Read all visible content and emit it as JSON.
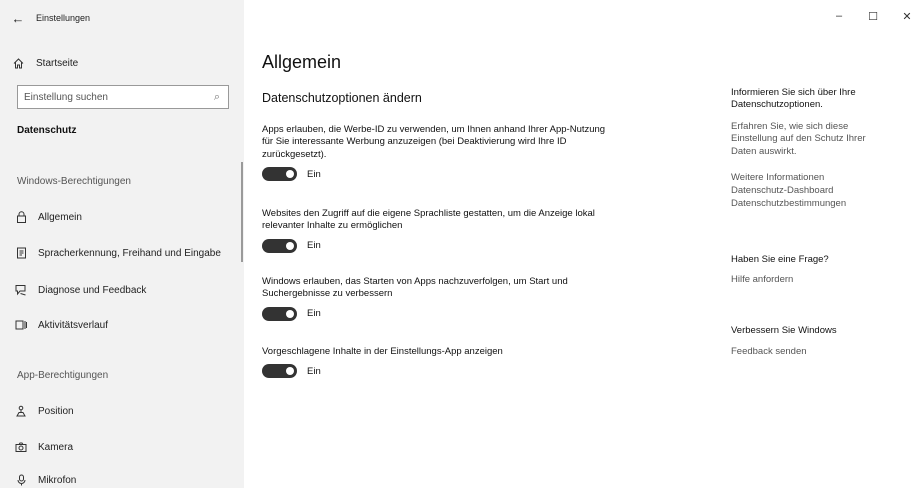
{
  "window": {
    "title": "Einstellungen",
    "controls": {
      "minimize": "–",
      "maximize": "☐",
      "close": "✕"
    }
  },
  "sidebar": {
    "home": {
      "label": "Startseite",
      "icon": "home-icon"
    },
    "search": {
      "placeholder": "Einstellung suchen",
      "value": ""
    },
    "section_title": "Datenschutz",
    "windows_permissions_heading": "Windows-Berechtigungen",
    "windows_items": [
      {
        "label": "Allgemein",
        "icon": "lock-icon",
        "selected": true
      },
      {
        "label": "Spracherkennung, Freihand und Eingabe",
        "icon": "speech-icon"
      },
      {
        "label": "Diagnose und Feedback",
        "icon": "feedback-icon"
      },
      {
        "label": "Aktivitätsverlauf",
        "icon": "activity-icon"
      }
    ],
    "app_permissions_heading": "App-Berechtigungen",
    "app_items": [
      {
        "label": "Position",
        "icon": "location-icon"
      },
      {
        "label": "Kamera",
        "icon": "camera-icon"
      },
      {
        "label": "Mikrofon",
        "icon": "microphone-icon"
      }
    ]
  },
  "main": {
    "title": "Allgemein",
    "subtitle": "Datenschutzoptionen ändern",
    "settings": [
      {
        "text": "Apps erlauben, die Werbe-ID zu verwenden, um Ihnen anhand Ihrer App-Nutzung für Sie interessante Werbung anzuzeigen (bei Deaktivierung wird Ihre ID zurückgesetzt).",
        "state": "Ein",
        "on": true
      },
      {
        "text": "Websites den Zugriff auf die eigene Sprachliste gestatten, um die Anzeige lokal relevanter Inhalte zu ermöglichen",
        "state": "Ein",
        "on": true
      },
      {
        "text": "Windows erlauben, das Starten von Apps nachzuverfolgen, um Start und Suchergebnisse zu verbessern",
        "state": "Ein",
        "on": true
      },
      {
        "text": "Vorgeschlagene Inhalte in der Einstellungs-App anzeigen",
        "state": "Ein",
        "on": true
      }
    ]
  },
  "right_panel": {
    "info_heading_line1": "Informieren Sie sich über Ihre",
    "info_heading_line2": "Datenschutzoptionen.",
    "info_text": "Erfahren Sie, wie sich diese Einstellung auf den Schutz Ihrer Daten auswirkt.",
    "links": [
      "Weitere Informationen",
      "Datenschutz-Dashboard",
      "Datenschutzbestimmungen"
    ],
    "question_heading": "Haben Sie eine Frage?",
    "help_link": "Hilfe anfordern",
    "improve_heading": "Verbessern Sie Windows",
    "feedback_link": "Feedback senden"
  }
}
